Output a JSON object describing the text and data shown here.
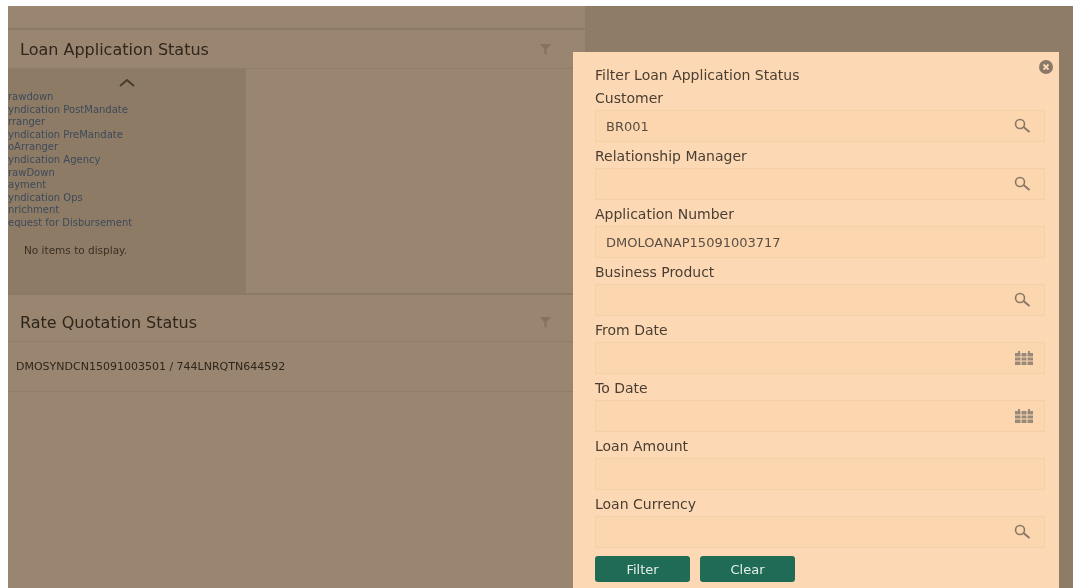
{
  "loan_panel": {
    "title": "Loan Application Status",
    "stages": [
      "rawdown",
      "yndication PostMandate",
      "rranger",
      "yndication PreMandate",
      "oArranger",
      "yndication Agency",
      "rawDown",
      "ayment",
      "yndication Ops",
      "nrichment",
      "equest for Disbursement"
    ],
    "empty_message": "No items to display."
  },
  "rate_panel": {
    "title": "Rate Quotation Status",
    "rows": [
      "DMOSYNDCN15091003501 / 744LNRQTN644592"
    ]
  },
  "filter": {
    "title": "Filter Loan Application Status",
    "fields": [
      {
        "label": "Customer",
        "kind": "lookup",
        "value": "BR001"
      },
      {
        "label": "Relationship Manager",
        "kind": "lookup"
      },
      {
        "label": "Application Number",
        "kind": "text",
        "value": "DMOLOANAP15091003717"
      },
      {
        "label": "Business Product",
        "kind": "lookup"
      },
      {
        "label": "From Date",
        "kind": "date"
      },
      {
        "label": "To Date",
        "kind": "date"
      },
      {
        "label": "Loan Amount",
        "kind": "text"
      },
      {
        "label": "Loan Currency",
        "kind": "lookup"
      }
    ],
    "buttons": [
      "Filter",
      "Clear"
    ]
  }
}
